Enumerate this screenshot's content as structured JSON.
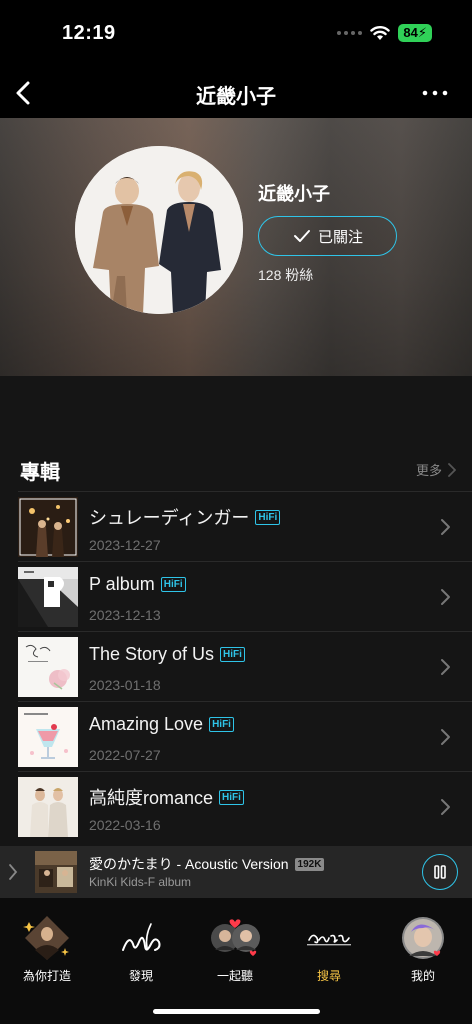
{
  "status": {
    "time": "12:19",
    "battery": "84"
  },
  "nav": {
    "title": "近畿小子"
  },
  "artist": {
    "name": "近畿小子",
    "follow_label": "已關注",
    "fans": "128 粉絲"
  },
  "albums_section": {
    "title": "專輯",
    "more_label": "更多",
    "items": [
      {
        "title": "シュレーディンガー",
        "badge": "HiFi",
        "date": "2023-12-27"
      },
      {
        "title": "P album",
        "badge": "HiFi",
        "date": "2023-12-13"
      },
      {
        "title": "The Story of Us",
        "badge": "HiFi",
        "date": "2023-01-18"
      },
      {
        "title": "Amazing Love",
        "badge": "HiFi",
        "date": "2022-07-27"
      },
      {
        "title": "高純度romance",
        "badge": "HiFi",
        "date": "2022-03-16"
      }
    ]
  },
  "player": {
    "title": "愛のかたまり - Acoustic Version",
    "quality": "192K",
    "subtitle": "KinKi Kids-F album"
  },
  "tabs": [
    {
      "label": "為你打造",
      "icon": "artist-diamond-icon",
      "active": false
    },
    {
      "label": "發現",
      "icon": "discover-script-icon",
      "active": false
    },
    {
      "label": "一起聽",
      "icon": "listen-together-icon",
      "active": false
    },
    {
      "label": "搜尋",
      "icon": "search-script-icon",
      "active": true
    },
    {
      "label": "我的",
      "icon": "profile-avatar-icon",
      "active": false
    }
  ],
  "colors": {
    "accent": "#2fc4e8",
    "active_tab": "#f6c445",
    "background": "#151515"
  }
}
